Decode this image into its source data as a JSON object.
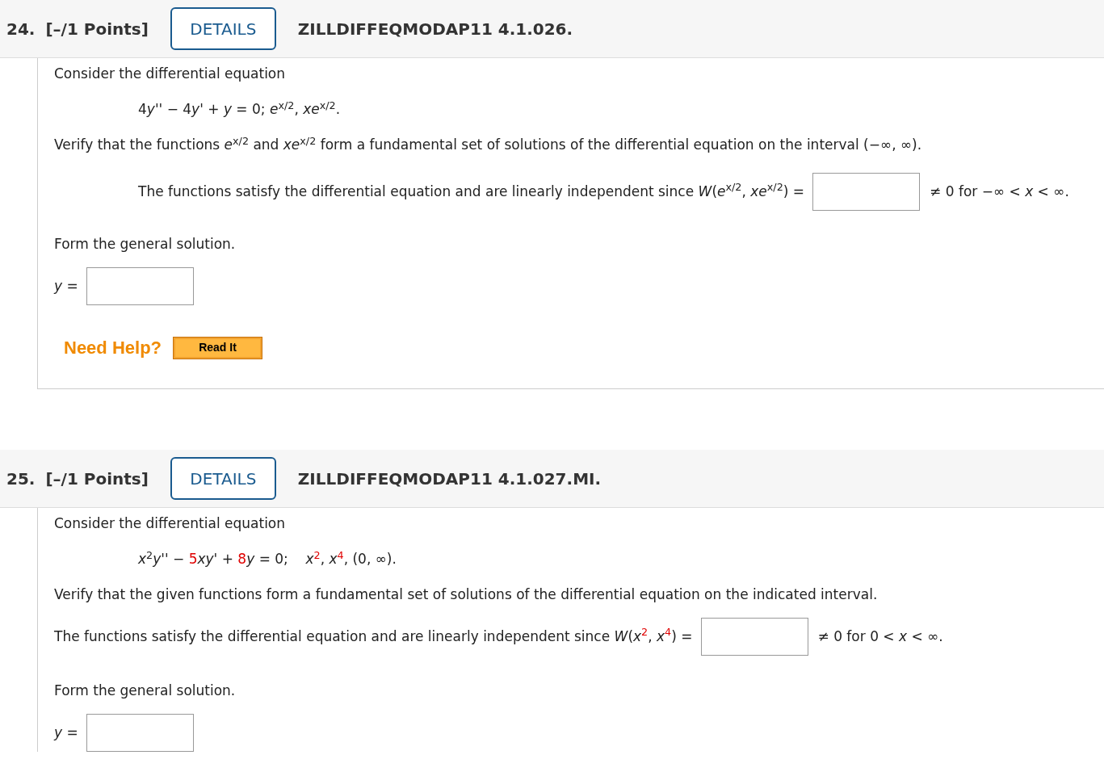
{
  "problems": [
    {
      "number": "24.",
      "points": "[–/1 Points]",
      "details": "DETAILS",
      "code": "ZILLDIFFEQMODAP11 4.1.026.",
      "closed": true,
      "blocks": [
        {
          "kind": "text",
          "text": "Consider the differential equation"
        },
        {
          "kind": "equation",
          "parts": [
            {
              "text": "4",
              "kind": "plain"
            },
            {
              "text": "*y*'' − 4",
              "kind": "plain"
            },
            {
              "text": "*y*' + *y* = 0; *e*$^{x/2}$, *xe*$^{x/2}$.",
              "kind": "plain"
            }
          ]
        },
        {
          "kind": "text",
          "text": "Verify that the functions *e*$^{x/2}$ and *xe*$^{x/2}$ form a fundamental set of solutions of the differential equation on the interval (−∞, ∞)."
        },
        {
          "kind": "answer",
          "indented": true,
          "parts": [
            {
              "text": "The functions satisfy the differential equation and are linearly independent since *W*(*e*$^{x/2}$, *xe*$^{x/2}$) =",
              "kind": "plain"
            }
          ],
          "post": "≠ 0 for −∞ < *x* < ∞."
        },
        {
          "kind": "text",
          "text": "Form the general solution."
        },
        {
          "kind": "solution",
          "label": "*y* ="
        },
        {
          "kind": "help",
          "label": "Need Help?",
          "button": "Read It"
        }
      ]
    },
    {
      "number": "25.",
      "points": "[–/1 Points]",
      "details": "DETAILS",
      "code": "ZILLDIFFEQMODAP11 4.1.027.MI.",
      "closed": false,
      "blocks": [
        {
          "kind": "text",
          "text": "Consider the differential equation"
        },
        {
          "kind": "equation",
          "parts": [
            {
              "text": "*x*$^{2}$*y*'' − ",
              "kind": "plain"
            },
            {
              "text": "5",
              "kind": "red"
            },
            {
              "text": "*xy*' + ",
              "kind": "plain"
            },
            {
              "text": "8",
              "kind": "red"
            },
            {
              "text": "*y* = 0;    *x*",
              "kind": "plain"
            },
            {
              "text": "$^{2}$",
              "kind": "red"
            },
            {
              "text": ", *x*",
              "kind": "plain"
            },
            {
              "text": "$^{4}$",
              "kind": "red"
            },
            {
              "text": ", (0, ∞).",
              "kind": "plain"
            }
          ]
        },
        {
          "kind": "text",
          "text": "Verify that the given functions form a fundamental set of solutions of the differential equation on the indicated interval."
        },
        {
          "kind": "answer",
          "indented": false,
          "parts": [
            {
              "text": "The functions satisfy the differential equation and are linearly independent since *W*(*x*",
              "kind": "plain"
            },
            {
              "text": "$^{2}$",
              "kind": "red"
            },
            {
              "text": ", *x*",
              "kind": "plain"
            },
            {
              "text": "$^{4}$",
              "kind": "red"
            },
            {
              "text": ") =",
              "kind": "plain"
            }
          ],
          "post": "≠ 0 for 0 < *x* < ∞."
        },
        {
          "kind": "text",
          "text": "Form the general solution."
        },
        {
          "kind": "solution",
          "label": "*y* ="
        }
      ]
    }
  ]
}
